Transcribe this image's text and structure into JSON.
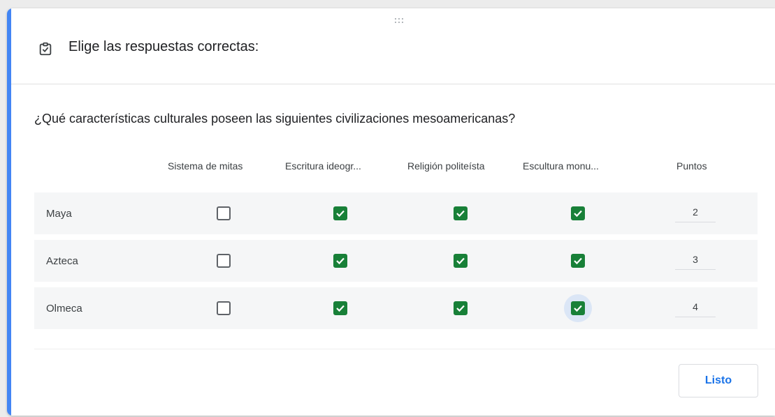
{
  "header": {
    "icon": "checklist-clipboard-icon",
    "title": "Elige las respuestas correctas:"
  },
  "question": {
    "text": "¿Qué características culturales poseen las siguientes civilizaciones mesoamericanas?"
  },
  "grid": {
    "columns": [
      "Sistema de mitas",
      "Escritura ideogr...",
      "Religión politeísta",
      "Escultura monu..."
    ],
    "points_header": "Puntos",
    "rows": [
      {
        "label": "Maya",
        "checked": [
          false,
          true,
          true,
          true
        ],
        "points": "2"
      },
      {
        "label": "Azteca",
        "checked": [
          false,
          true,
          true,
          true
        ],
        "points": "3"
      },
      {
        "label": "Olmeca",
        "checked": [
          false,
          true,
          true,
          true
        ],
        "points": "4"
      }
    ]
  },
  "footer": {
    "done_label": "Listo"
  },
  "colors": {
    "accent": "#4285f4",
    "checked": "#188038",
    "button_text": "#1a73e8"
  }
}
